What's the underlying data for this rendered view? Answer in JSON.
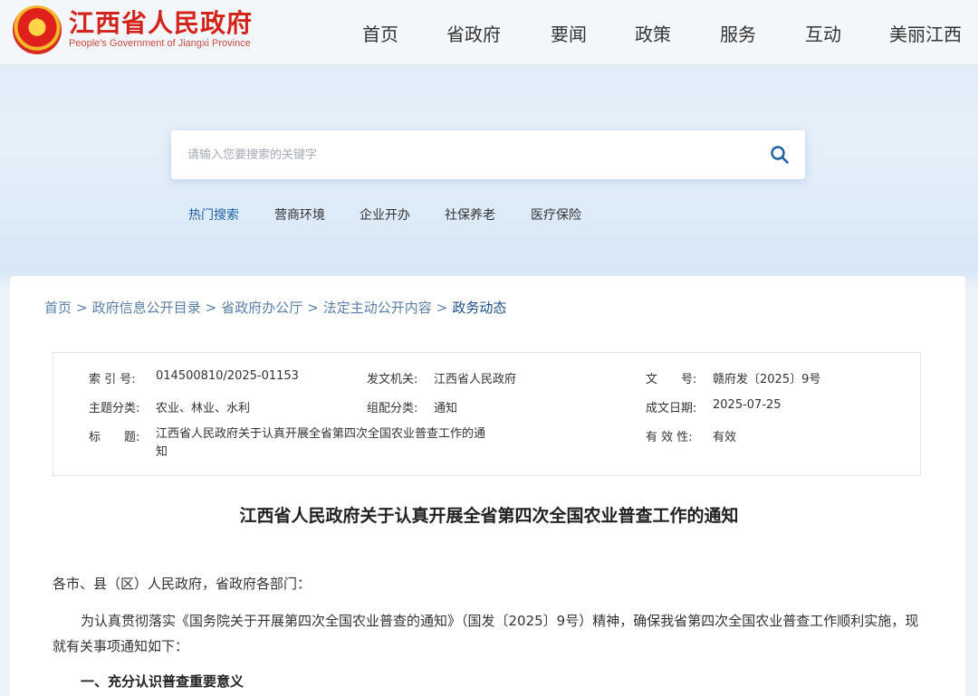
{
  "header": {
    "brand_cn": "江西省人民政府",
    "brand_en": "People's Government of Jiangxi Province",
    "nav": [
      "首页",
      "省政府",
      "要闻",
      "政策",
      "服务",
      "互动",
      "美丽江西"
    ]
  },
  "search": {
    "placeholder": "请输入您要搜索的关键字",
    "hot_label": "热门搜索",
    "hot_terms": [
      "营商环境",
      "企业开办",
      "社保养老",
      "医疗保险"
    ]
  },
  "breadcrumb": [
    "首页",
    "政府信息公开目录",
    "省政府办公厅",
    "法定主动公开内容",
    "政务动态"
  ],
  "meta": {
    "index_label": "索 引 号:",
    "index_value": "014500810/2025-01153",
    "issuer_label": "发文机关:",
    "issuer_value": "江西省人民政府",
    "docno_label": "文　　号:",
    "docno_value": "赣府发〔2025〕9号",
    "topic_label": "主题分类:",
    "topic_value": "农业、林业、水利",
    "genre_label": "组配分类:",
    "genre_value": "通知",
    "date_label": "成文日期:",
    "date_value": "2025-07-25",
    "title_label": "标　　题:",
    "title_value": "江西省人民政府关于认真开展全省第四次全国农业普查工作的通知",
    "valid_label": "有 效 性:",
    "valid_value": "有效"
  },
  "document": {
    "title": "江西省人民政府关于认真开展全省第四次全国农业普查工作的通知",
    "salutation": "各市、县（区）人民政府，省政府各部门：",
    "para1": "为认真贯彻落实《国务院关于开展第四次全国农业普查的通知》（国发〔2025〕9号）精神，确保我省第四次全国农业普查工作顺利实施，现就有关事项通知如下：",
    "section1": "一、充分认识普查重要意义"
  },
  "colors": {
    "brand_red": "#d3241b",
    "link_blue": "#1e5fa8",
    "breadcrumb_blue": "#5a7fa8"
  }
}
